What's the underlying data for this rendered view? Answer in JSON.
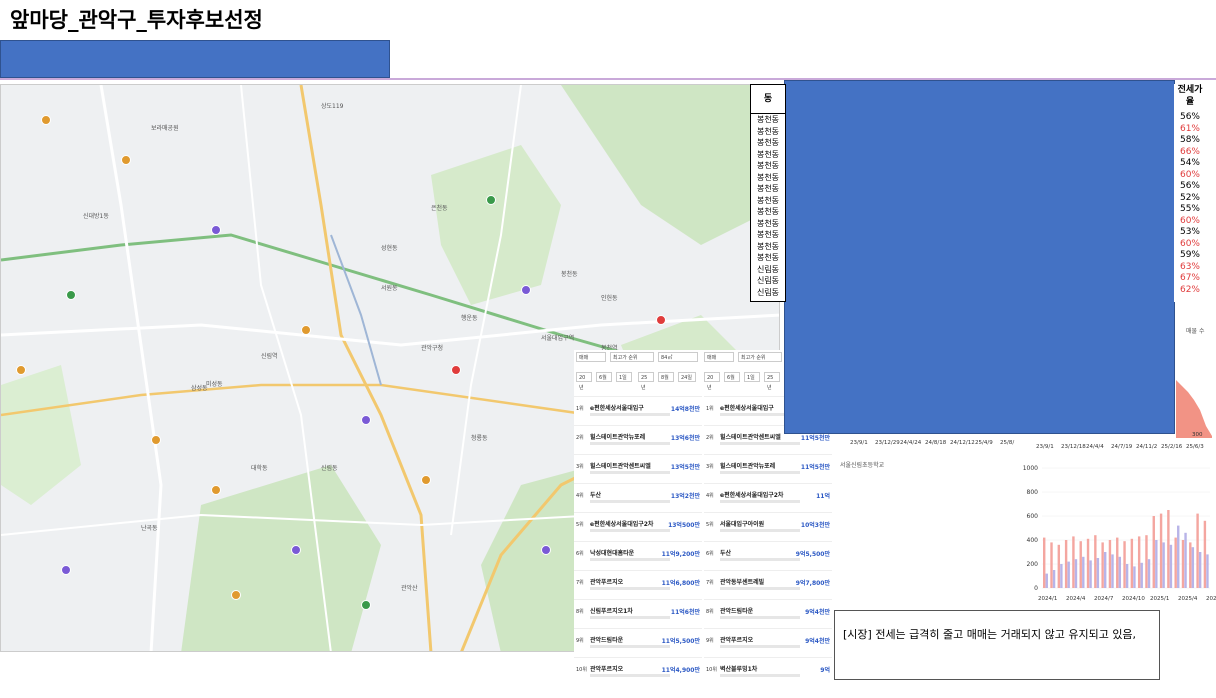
{
  "title": "앞마당_관악구_투자후보선정",
  "colors": {
    "blue_block": "#4472c4",
    "red_rate": "#e03c3c",
    "accent_line": "#c9a9d9"
  },
  "table": {
    "dong_header": "동",
    "rate_header": "전세가율",
    "dongs": [
      "봉천동",
      "봉천동",
      "봉천동",
      "봉천동",
      "봉천동",
      "봉천동",
      "봉천동",
      "봉천동",
      "봉천동",
      "봉천동",
      "봉천동",
      "봉천동",
      "봉천동",
      "신림동",
      "신림동",
      "신림동"
    ],
    "rates": [
      {
        "v": "56%",
        "red": false
      },
      {
        "v": "61%",
        "red": true
      },
      {
        "v": "58%",
        "red": false
      },
      {
        "v": "66%",
        "red": true
      },
      {
        "v": "54%",
        "red": false
      },
      {
        "v": "60%",
        "red": true
      },
      {
        "v": "56%",
        "red": false
      },
      {
        "v": "52%",
        "red": false
      },
      {
        "v": "55%",
        "red": false
      },
      {
        "v": "60%",
        "red": true
      },
      {
        "v": "53%",
        "red": false
      },
      {
        "v": "60%",
        "red": true
      },
      {
        "v": "59%",
        "red": false
      },
      {
        "v": "63%",
        "red": true
      },
      {
        "v": "67%",
        "red": true
      },
      {
        "v": "62%",
        "red": true
      }
    ]
  },
  "note": {
    "text": "[시장] 전세는 급격히 줄고 매매는 거래되지 않고 유지되고 있음,"
  },
  "side_label": "매물 수",
  "chart_top": {
    "x_ticks_left": [
      "23/9/1",
      "23/12/29",
      "24/4/24",
      "24/8/18",
      "24/12/12",
      "25/4/9",
      "25/8/"
    ],
    "x_ticks_right": [
      "23/9/1",
      "23/12/18",
      "24/4/4",
      "24/7/19",
      "24/11/2",
      "25/2/16",
      "25/6/3"
    ],
    "y_tick_right": "300"
  },
  "chart_data": {
    "type": "bar",
    "yticks": [
      "1000",
      "800",
      "600",
      "400",
      "200",
      "0"
    ],
    "ylim": [
      0,
      1000
    ],
    "x_ticks": [
      "2024/1",
      "2024/4",
      "2024/7",
      "2024/10",
      "2025/1",
      "2025/4",
      "2025/7"
    ],
    "series": [
      {
        "color": "#f4a6a0",
        "values": [
          420,
          380,
          360,
          400,
          430,
          390,
          410,
          440,
          380,
          400,
          420,
          390,
          410,
          430,
          440,
          600,
          620,
          650,
          420,
          400,
          380,
          620,
          560
        ]
      },
      {
        "color": "#b8b4e8",
        "values": [
          120,
          150,
          200,
          220,
          240,
          260,
          230,
          250,
          300,
          280,
          260,
          200,
          180,
          210,
          240,
          400,
          380,
          360,
          520,
          460,
          340,
          300,
          280
        ]
      }
    ]
  },
  "map": {
    "labels": [
      "봉천역",
      "신림역",
      "서울대입구역",
      "관악구청",
      "신대방1동",
      "보라매공원",
      "상도119",
      "봉천동",
      "관악산",
      "서원동",
      "신림동",
      "난곡동",
      "삼성동",
      "대학동",
      "미성동",
      "은천동",
      "청룡동",
      "행운동",
      "성현동",
      "인헌동"
    ]
  },
  "rank": {
    "filters": [
      "매매",
      "최고가 순위",
      "84㎡",
      "매매",
      "최고가 순위",
      "20년",
      "6월",
      "1일",
      "25년",
      "8월",
      "24일",
      "20년",
      "6월",
      "1일",
      "25년"
    ],
    "rows": [
      {
        "n": "1위",
        "name": "e편한세상서울대입구",
        "price": "14억8천만"
      },
      {
        "n": "2위",
        "name": "힐스테이트관악뉴포레",
        "price": "13억6천만"
      },
      {
        "n": "3위",
        "name": "힐스테이트관악센트씨엘",
        "price": "13억5천만"
      },
      {
        "n": "4위",
        "name": "두산",
        "price": "13억2천만"
      },
      {
        "n": "5위",
        "name": "e편한세상서울대입구2차",
        "price": "13억500만"
      },
      {
        "n": "6위",
        "name": "낙성대현대홈타운",
        "price": "11억9,200만"
      },
      {
        "n": "7위",
        "name": "관악푸르지오",
        "price": "11억6,800만"
      },
      {
        "n": "8위",
        "name": "신림푸르지오1차",
        "price": "11억6천만"
      },
      {
        "n": "9위",
        "name": "관악드림타운",
        "price": "11억5,500만"
      },
      {
        "n": "10위",
        "name": "관악푸르지오",
        "price": "11억4,900만"
      }
    ],
    "rows2": [
      {
        "n": "1위",
        "name": "e편한세상서울대입구",
        "price": "11억"
      },
      {
        "n": "2위",
        "name": "힐스테이트관악센트씨엘",
        "price": "11억5천만"
      },
      {
        "n": "3위",
        "name": "힐스테이트관악뉴포레",
        "price": "11억5천만"
      },
      {
        "n": "4위",
        "name": "e편한세상서울대입구2차",
        "price": "11억"
      },
      {
        "n": "5위",
        "name": "서울대입구아이원",
        "price": "10억3천만"
      },
      {
        "n": "6위",
        "name": "두산",
        "price": "9억5,500만"
      },
      {
        "n": "7위",
        "name": "관악동부센트레빌",
        "price": "9억7,800만"
      },
      {
        "n": "8위",
        "name": "관악드림타운",
        "price": "9억4천만"
      },
      {
        "n": "9위",
        "name": "관악푸르지오",
        "price": "9억4천만"
      },
      {
        "n": "10위",
        "name": "벽산블루밍1차",
        "price": "9억"
      }
    ]
  }
}
